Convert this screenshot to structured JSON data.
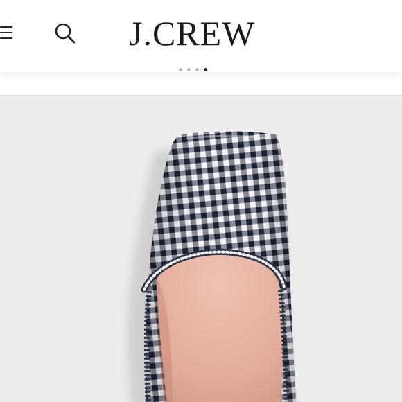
{
  "header": {
    "logo_text": "J.CREW",
    "menu_icon": "hamburger-menu-icon",
    "search_icon": "search-icon"
  },
  "carousel": {
    "dot_count": 4,
    "active_index": 3
  },
  "product": {
    "image": "gingham-flat-shoe",
    "pattern_colors": {
      "dark": "#2a3245",
      "light": "#f4f4f6",
      "lining": "#e9b6a6"
    }
  },
  "colors": {
    "header_bg": "#ffffff",
    "product_bg": "#eeedeb",
    "divider": "#e4e4e4"
  }
}
